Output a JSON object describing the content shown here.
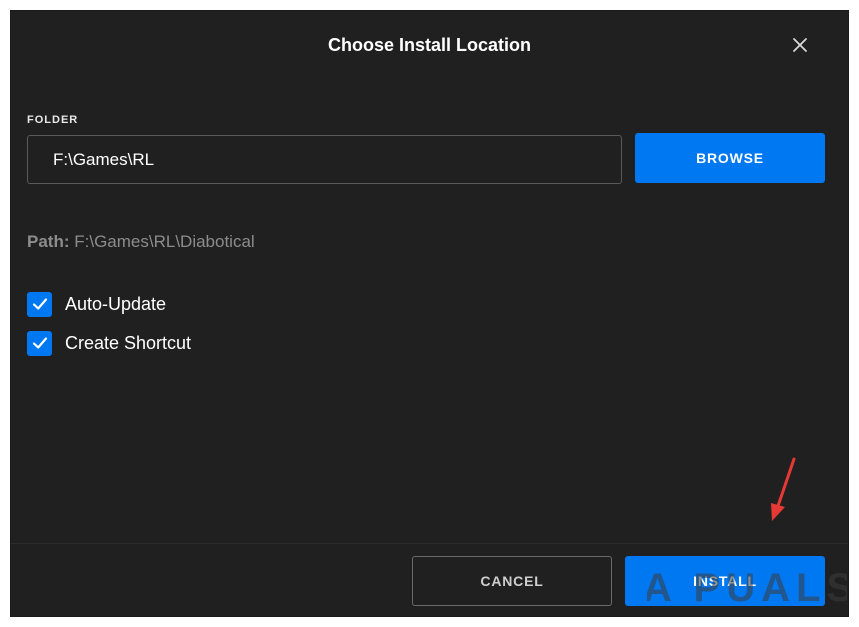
{
  "dialog": {
    "title": "Choose Install Location",
    "close_icon": "close-icon"
  },
  "folder": {
    "label": "FOLDER",
    "value": "F:\\Games\\RL",
    "browse_label": "BROWSE"
  },
  "path": {
    "key": "Path:",
    "value": "F:\\Games\\RL\\Diabotical"
  },
  "options": [
    {
      "label": "Auto-Update",
      "checked": true
    },
    {
      "label": "Create Shortcut",
      "checked": true
    }
  ],
  "footer": {
    "cancel_label": "CANCEL",
    "install_label": "INSTALL"
  },
  "watermark": {
    "text": "A PUALS"
  },
  "colors": {
    "dialog_bg": "#202020",
    "accent": "#0078f2",
    "muted_text": "#8c8c8c",
    "arrow": "#e53935"
  }
}
